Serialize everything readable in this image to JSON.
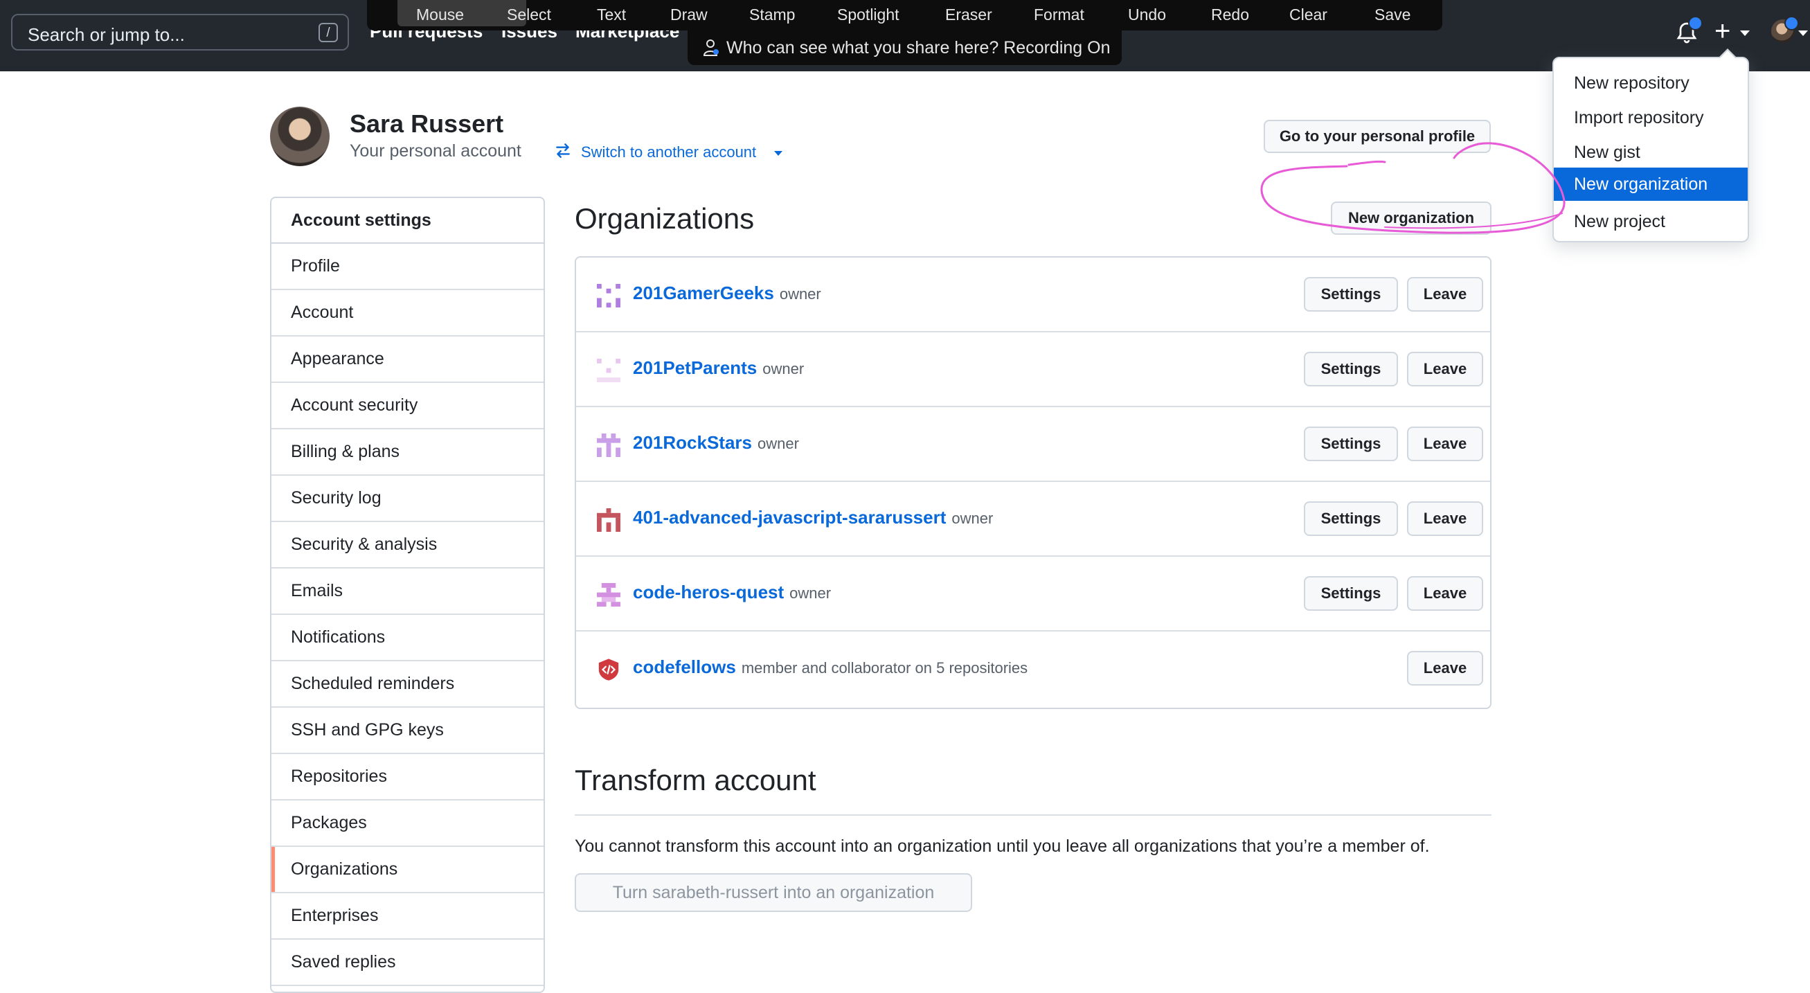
{
  "header": {
    "search_placeholder": "Search or jump to...",
    "search_shortcut": "/",
    "nav": [
      "Pull requests",
      "Issues",
      "Marketplace"
    ]
  },
  "recorder": {
    "tools": [
      "Mouse",
      "Select",
      "Text",
      "Draw",
      "Stamp",
      "Spotlight",
      "Eraser",
      "Format",
      "Undo",
      "Redo",
      "Clear",
      "Save"
    ],
    "notice": "Who can see what you share here? Recording On"
  },
  "dropdown": {
    "items": [
      "New repository",
      "Import repository",
      "New gist",
      "New organization",
      "New project"
    ],
    "active": "New organization"
  },
  "profile": {
    "name": "Sara Russert",
    "subtitle": "Your personal account",
    "switch_label": "Switch to another account",
    "goto_label": "Go to your personal profile"
  },
  "sidebar": {
    "header": "Account settings",
    "items": [
      "Profile",
      "Account",
      "Appearance",
      "Account security",
      "Billing & plans",
      "Security log",
      "Security & analysis",
      "Emails",
      "Notifications",
      "Scheduled reminders",
      "SSH and GPG keys",
      "Repositories",
      "Packages",
      "Organizations",
      "Enterprises",
      "Saved replies"
    ],
    "active": "Organizations"
  },
  "organizations": {
    "title": "Organizations",
    "new_button": "New organization",
    "settings_label": "Settings",
    "leave_label": "Leave",
    "rows": [
      {
        "name": "201GamerGeeks",
        "role": "owner",
        "settings": true
      },
      {
        "name": "201PetParents",
        "role": "owner",
        "settings": true
      },
      {
        "name": "201RockStars",
        "role": "owner",
        "settings": true
      },
      {
        "name": "401-advanced-javascript-sararussert",
        "role": "owner",
        "settings": true
      },
      {
        "name": "code-heros-quest",
        "role": "owner",
        "settings": true
      },
      {
        "name": "codefellows",
        "role": "member and collaborator on 5 repositories",
        "settings": false
      }
    ]
  },
  "transform": {
    "title": "Transform account",
    "text": "You cannot transform this account into an organization until you leave all organizations that you’re a member of.",
    "button": "Turn sarabeth-russert into an organization"
  },
  "colors": {
    "header_bg": "#24292f",
    "link": "#0969da",
    "accent_active": "#fd8c73",
    "annotation": "#e85bd6"
  }
}
